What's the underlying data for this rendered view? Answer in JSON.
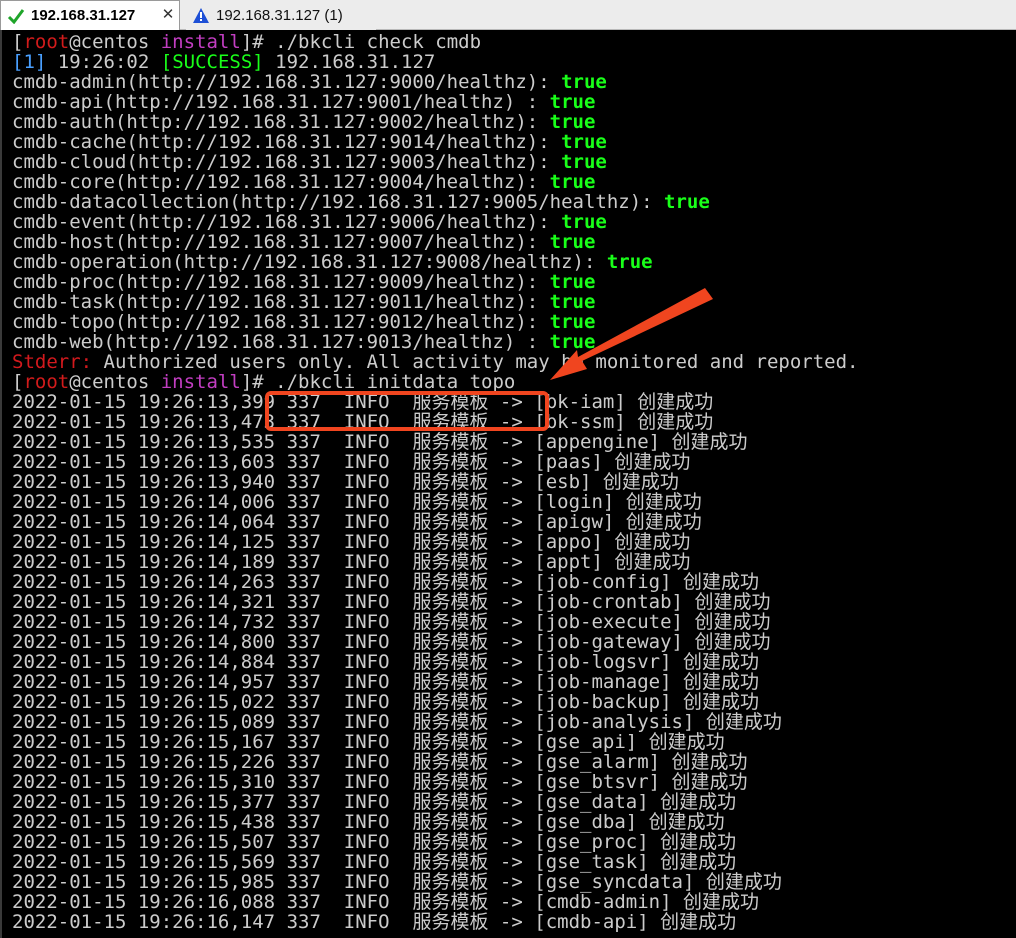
{
  "tabs": [
    {
      "label": "192.168.31.127",
      "status_icon": "checkmark-icon",
      "active": true
    },
    {
      "label": "192.168.31.127 (1)",
      "status_icon": "warning-icon",
      "active": false
    }
  ],
  "colors": {
    "background": "#000000",
    "text": "#cccccc",
    "success": "#19ff19",
    "prompt_red": "#d21b1b",
    "prompt_magenta": "#c23ec2",
    "annotation": "#f0451f"
  },
  "prompt1": {
    "open": "[",
    "user": "root",
    "at": "@centos ",
    "dir": "install",
    "close": "]",
    "cmd": "# ./bkcli check cmdb"
  },
  "status_line": {
    "idx_open": "[",
    "idx": "1",
    "idx_close": "]",
    "time": " 19:26:02 ",
    "tag_open": "[",
    "tag": "SUCCESS",
    "tag_close": "]",
    "host": " 192.168.31.127"
  },
  "health": [
    {
      "text": "cmdb-admin(http://192.168.31.127:9000/healthz): ",
      "result": "true"
    },
    {
      "text": "cmdb-api(http://192.168.31.127:9001/healthz) : ",
      "result": "true"
    },
    {
      "text": "cmdb-auth(http://192.168.31.127:9002/healthz): ",
      "result": "true"
    },
    {
      "text": "cmdb-cache(http://192.168.31.127:9014/healthz): ",
      "result": "true"
    },
    {
      "text": "cmdb-cloud(http://192.168.31.127:9003/healthz): ",
      "result": "true"
    },
    {
      "text": "cmdb-core(http://192.168.31.127:9004/healthz): ",
      "result": "true"
    },
    {
      "text": "cmdb-datacollection(http://192.168.31.127:9005/healthz): ",
      "result": "true"
    },
    {
      "text": "cmdb-event(http://192.168.31.127:9006/healthz): ",
      "result": "true"
    },
    {
      "text": "cmdb-host(http://192.168.31.127:9007/healthz): ",
      "result": "true"
    },
    {
      "text": "cmdb-operation(http://192.168.31.127:9008/healthz): ",
      "result": "true"
    },
    {
      "text": "cmdb-proc(http://192.168.31.127:9009/healthz): ",
      "result": "true"
    },
    {
      "text": "cmdb-task(http://192.168.31.127:9011/healthz): ",
      "result": "true"
    },
    {
      "text": "cmdb-topo(http://192.168.31.127:9012/healthz): ",
      "result": "true"
    },
    {
      "text": "cmdb-web(http://192.168.31.127:9013/healthz) : ",
      "result": "true"
    }
  ],
  "stderr": {
    "label": "Stderr:",
    "message": " Authorized users only. All activity may be monitored and reported."
  },
  "prompt2": {
    "open": "[",
    "user": "root",
    "at": "@centos ",
    "dir": "install",
    "close": "]",
    "cmd": "# ./bkcli initdata topo"
  },
  "log_fixed": {
    "date": "2022-01-15",
    "pid": "337",
    "level": "INFO",
    "label": "服务模板",
    "arrow": "->",
    "suffix": "创建成功"
  },
  "logs": [
    {
      "time": "19:26:13,399",
      "name": "bk-iam"
    },
    {
      "time": "19:26:13,473",
      "name": "bk-ssm"
    },
    {
      "time": "19:26:13,535",
      "name": "appengine"
    },
    {
      "time": "19:26:13,603",
      "name": "paas"
    },
    {
      "time": "19:26:13,940",
      "name": "esb"
    },
    {
      "time": "19:26:14,006",
      "name": "login"
    },
    {
      "time": "19:26:14,064",
      "name": "apigw"
    },
    {
      "time": "19:26:14,125",
      "name": "appo"
    },
    {
      "time": "19:26:14,189",
      "name": "appt"
    },
    {
      "time": "19:26:14,263",
      "name": "job-config"
    },
    {
      "time": "19:26:14,321",
      "name": "job-crontab"
    },
    {
      "time": "19:26:14,732",
      "name": "job-execute"
    },
    {
      "time": "19:26:14,800",
      "name": "job-gateway"
    },
    {
      "time": "19:26:14,884",
      "name": "job-logsvr"
    },
    {
      "time": "19:26:14,957",
      "name": "job-manage"
    },
    {
      "time": "19:26:15,022",
      "name": "job-backup"
    },
    {
      "time": "19:26:15,089",
      "name": "job-analysis"
    },
    {
      "time": "19:26:15,167",
      "name": "gse_api"
    },
    {
      "time": "19:26:15,226",
      "name": "gse_alarm"
    },
    {
      "time": "19:26:15,310",
      "name": "gse_btsvr"
    },
    {
      "time": "19:26:15,377",
      "name": "gse_data"
    },
    {
      "time": "19:26:15,438",
      "name": "gse_dba"
    },
    {
      "time": "19:26:15,507",
      "name": "gse_proc"
    },
    {
      "time": "19:26:15,569",
      "name": "gse_task"
    },
    {
      "time": "19:26:15,985",
      "name": "gse_syncdata"
    },
    {
      "time": "19:26:16,088",
      "name": "cmdb-admin"
    },
    {
      "time": "19:26:16,147",
      "name": "cmdb-api"
    }
  ]
}
